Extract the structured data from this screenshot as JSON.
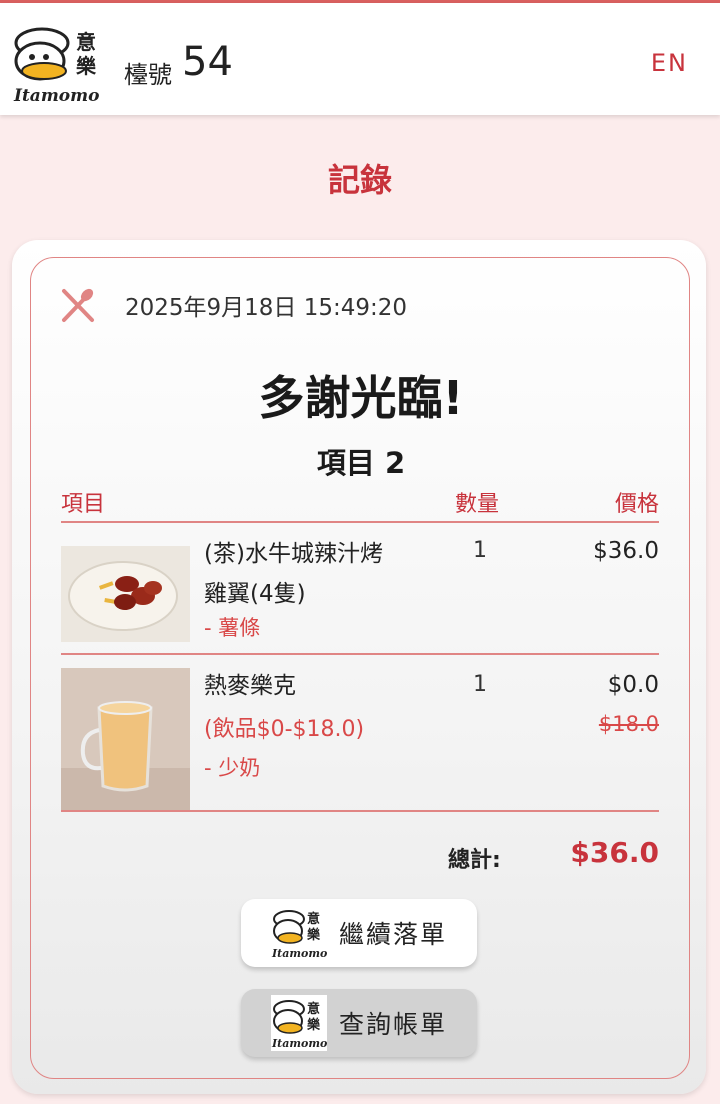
{
  "brand": {
    "logo_text": "Itamomo",
    "logo_chars": [
      "意",
      "樂"
    ]
  },
  "header": {
    "table_label": "檯號",
    "table_number": "54",
    "language_toggle": "EN"
  },
  "page_title": "記錄",
  "order": {
    "timestamp": "2025年9月18日 15:49:20",
    "thanks": "多謝光臨!",
    "items_count": "項目 2",
    "columns": {
      "item": "項目",
      "qty": "數量",
      "price": "價格"
    },
    "items": [
      {
        "name_line1": "(茶)水牛城辣汁烤",
        "name_line2": "雞翼(4隻)",
        "option": "- 薯條",
        "qty": "1",
        "price": "$36.0"
      },
      {
        "name_line1": "熱麥樂克",
        "price_note": "(飲品$0-$18.0)",
        "option": "- 少奶",
        "qty": "1",
        "price": "$0.0",
        "original_price": "$18.0"
      }
    ],
    "total_label": "總計:",
    "total_value": "$36.0"
  },
  "buttons": {
    "continue_order": "繼續落單",
    "check_bill": "查詢帳單"
  },
  "colors": {
    "accent": "#c8333c",
    "light_accent": "#e08584",
    "background": "#fcecec"
  }
}
